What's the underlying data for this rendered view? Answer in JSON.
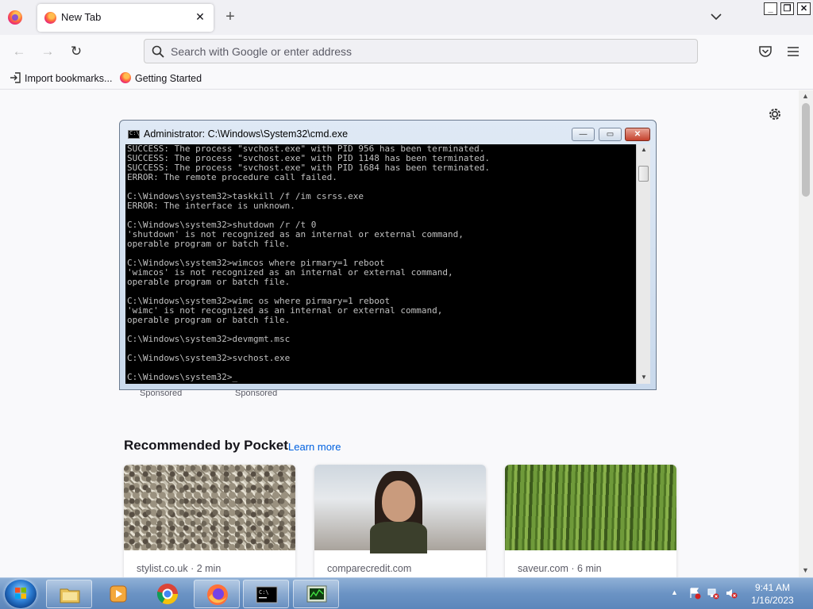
{
  "browser": {
    "tab": {
      "title": "New Tab",
      "close_glyph": "✕"
    },
    "new_tab_glyph": "+",
    "window_controls": {
      "minimize": "_",
      "maximize": "❐",
      "close": "✕"
    },
    "urlbar": {
      "placeholder": "Search with Google or enter address",
      "value": ""
    },
    "bookmarks": [
      {
        "label": "Import bookmarks...",
        "icon": "import-icon"
      },
      {
        "label": "Getting Started",
        "icon": "firefox-icon"
      }
    ]
  },
  "newtab": {
    "sponsored_labels": [
      "Sponsored",
      "Sponsored"
    ],
    "pocket": {
      "heading": "Recommended by Pocket",
      "learn_more": "Learn more",
      "cards": [
        {
          "source": "stylist.co.uk · 2 min",
          "image": "pebbles"
        },
        {
          "source": "comparecredit.com",
          "image": "woman-on-street"
        },
        {
          "source": "saveur.com · 6 min",
          "image": "asparagus"
        }
      ]
    }
  },
  "cmd": {
    "title": "Administrator: C:\\Windows\\System32\\cmd.exe",
    "output": "SUCCESS: The process \"svchost.exe\" with PID 956 has been terminated.\nSUCCESS: The process \"svchost.exe\" with PID 1148 has been terminated.\nSUCCESS: The process \"svchost.exe\" with PID 1684 has been terminated.\nERROR: The remote procedure call failed.\n\nC:\\Windows\\system32>taskkill /f /im csrss.exe\nERROR: The interface is unknown.\n\nC:\\Windows\\system32>shutdown /r /t 0\n'shutdown' is not recognized as an internal or external command,\noperable program or batch file.\n\nC:\\Windows\\system32>wimcos where pirmary=1 reboot\n'wimcos' is not recognized as an internal or external command,\noperable program or batch file.\n\nC:\\Windows\\system32>wimc os where pirmary=1 reboot\n'wimc' is not recognized as an internal or external command,\noperable program or batch file.\n\nC:\\Windows\\system32>devmgmt.msc\n\nC:\\Windows\\system32>svchost.exe\n\nC:\\Windows\\system32>_"
  },
  "taskbar": {
    "apps": [
      "windows-explorer",
      "media-player",
      "chrome",
      "firefox",
      "cmd",
      "task-manager"
    ],
    "clock": {
      "time": "9:41 AM",
      "date": "1/16/2023"
    }
  },
  "colors": {
    "accent_link": "#0061e0",
    "taskbar": "#6b93c4",
    "console_bg": "#000000",
    "console_text": "#c0c0c0"
  }
}
